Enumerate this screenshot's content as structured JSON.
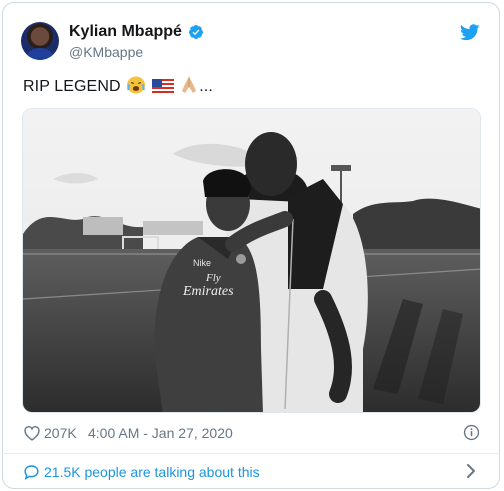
{
  "tweet": {
    "author_name": "Kylian Mbappé",
    "author_handle": "@KMbappe",
    "text": "RIP LEGEND",
    "emoji_trail": "...",
    "likes": "207K",
    "timestamp": "4:00 AM - Jan 27, 2020"
  },
  "conversation": {
    "label": "21.5K people are talking about this"
  },
  "icons": {
    "verified": "verified-badge-icon",
    "brand": "twitter-bird-icon",
    "like": "heart-icon",
    "info": "info-icon",
    "reply": "speech-bubble-icon",
    "more": "chevron-right-icon"
  },
  "photo": {
    "shirt_brand": "Nike",
    "sponsor_line1": "Fly",
    "sponsor_line2": "Emirates"
  },
  "colors": {
    "brand_blue": "#1da1f2",
    "link_blue": "#1b95e0",
    "muted_text": "#657786",
    "border": "#cfd9de"
  }
}
